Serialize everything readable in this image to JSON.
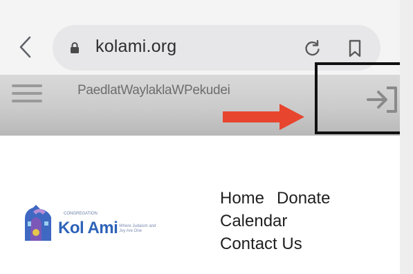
{
  "browser": {
    "back_icon": "chevron-left-icon",
    "lock_icon": "lock-icon",
    "url": "kolami.org",
    "reload_icon": "reload-icon",
    "bookmark_icon": "bookmark-icon"
  },
  "header": {
    "menu_icon": "hamburger-menu-icon",
    "overlapping_text": "PaedlatWaylaklaWPekudei",
    "login_icon": "sign-in-icon",
    "annotation_arrow_color": "#e8452e",
    "annotation_box_color": "#111111"
  },
  "logo": {
    "small_caption": "CONGREGATION",
    "name": "Kol Ami",
    "tagline": "Where Judaism and Joy Are One"
  },
  "nav": {
    "home": "Home",
    "donate": "Donate",
    "calendar": "Calendar",
    "contact": "Contact Us"
  },
  "colors": {
    "logo_blue": "#2d62b8",
    "logo_purple": "#8e5ab5",
    "header_gray": "#cbcbcb"
  }
}
